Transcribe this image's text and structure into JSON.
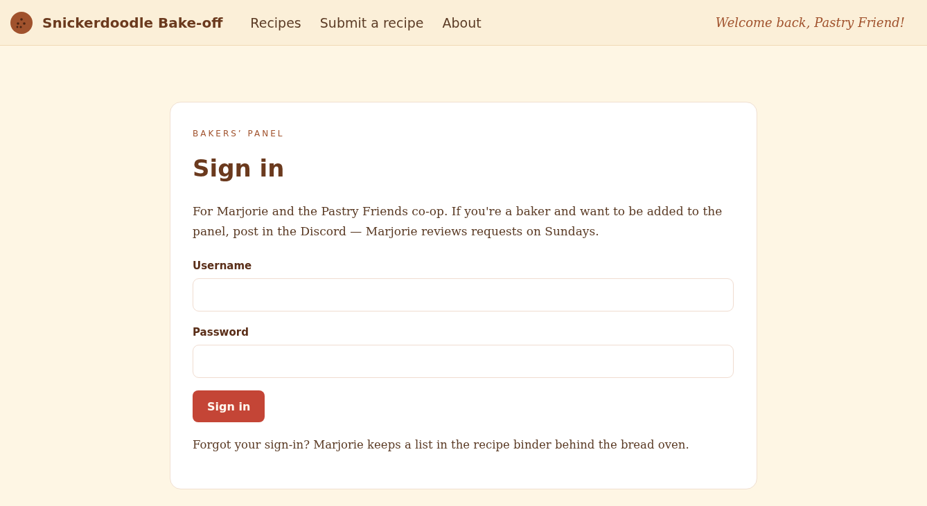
{
  "header": {
    "brand": "Snickerdoodle Bake-off",
    "nav": [
      "Recipes",
      "Submit a recipe",
      "About"
    ],
    "greeting": "Welcome back, Pastry Friend!"
  },
  "card": {
    "kicker": "BAKERS’ PANEL",
    "title": "Sign in",
    "intro": "For Marjorie and the Pastry Friends co-op. If you're a baker and want to be added to the panel, post in the Discord — Marjorie reviews requests on Sundays.",
    "fields": [
      {
        "label": "Username"
      },
      {
        "label": "Password"
      }
    ],
    "button": "Sign in",
    "footnote": "Forgot your sign-in? Marjorie keeps a list in the recipe binder behind the bread oven."
  }
}
